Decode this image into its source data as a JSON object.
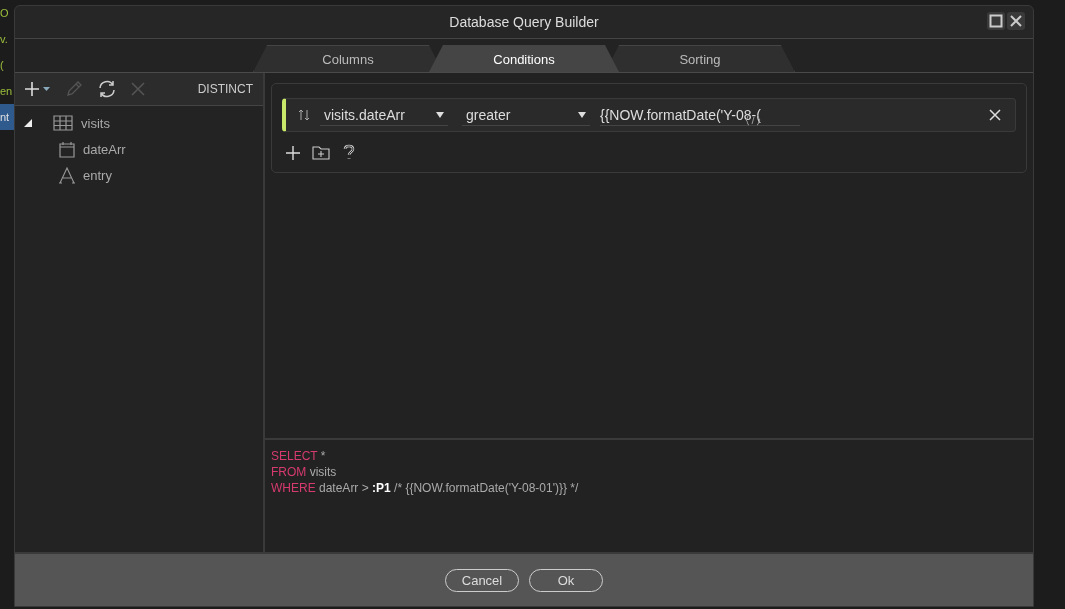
{
  "background_editor": [
    {
      "text": "O",
      "highlighted": false
    },
    {
      "text": "v.",
      "highlighted": false
    },
    {
      "text": "(",
      "highlighted": false
    },
    {
      "text": "en",
      "highlighted": false
    },
    {
      "text": "nt",
      "highlighted": true
    }
  ],
  "window": {
    "title": "Database Query Builder"
  },
  "tabs": [
    {
      "label": "Columns",
      "selected": false
    },
    {
      "label": "Conditions",
      "selected": true
    },
    {
      "label": "Sorting",
      "selected": false
    }
  ],
  "toolbar": {
    "distinct": "DISTINCT"
  },
  "tree": [
    {
      "label": "visits",
      "kind": "table",
      "expanded": true,
      "children": [
        {
          "label": "dateArr",
          "kind": "date"
        },
        {
          "label": "entry",
          "kind": "text"
        }
      ]
    }
  ],
  "conditions": [
    {
      "field": "visits.dateArr",
      "operator": "greater",
      "value": "{{NOW.formatDate('Y-08-("
    }
  ],
  "sql": [
    {
      "keyword": "SELECT",
      "rest": "*"
    },
    {
      "keyword": "FROM",
      "rest": "visits"
    },
    {
      "keyword": "WHERE",
      "rest": "dateArr > **:P1** /* {{NOW.formatDate('Y-08-01')}} */"
    }
  ],
  "buttons": [
    "Cancel",
    "Ok"
  ]
}
